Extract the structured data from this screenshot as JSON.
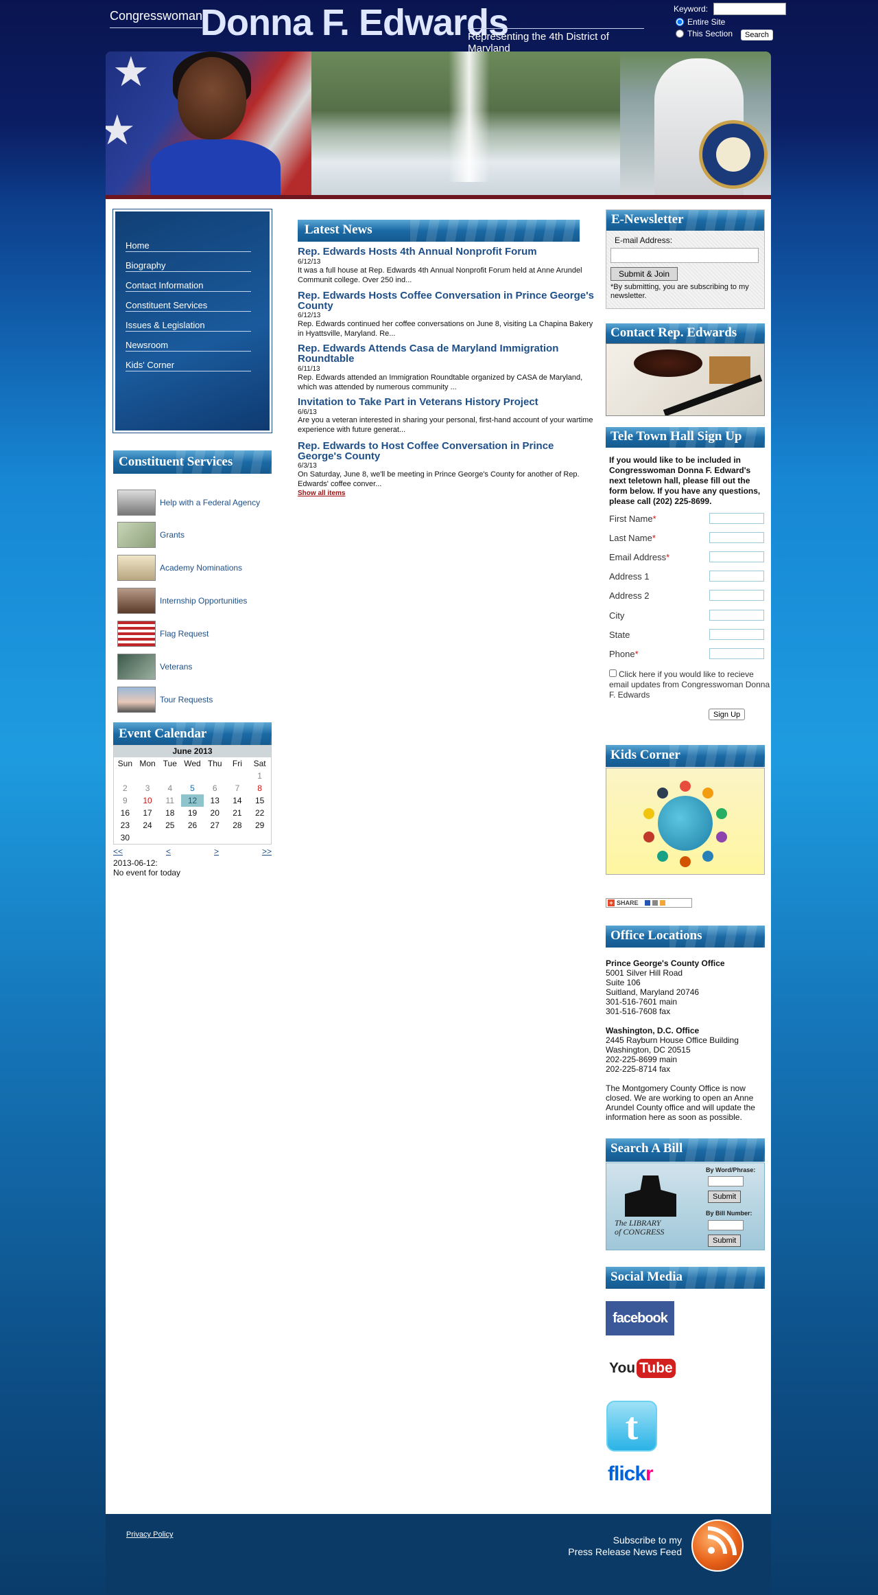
{
  "header": {
    "congresswoman": "Congresswoman",
    "name": "Donna F. Edwards",
    "district": "Representing the 4th District of Maryland"
  },
  "search": {
    "keyword_label": "Keyword:",
    "keyword_value": "",
    "scope_entire": "Entire Site",
    "scope_section": "This Section",
    "selected_scope": "Entire Site",
    "button": "Search"
  },
  "nav": {
    "items": [
      {
        "label": "Home"
      },
      {
        "label": "Biography"
      },
      {
        "label": "Contact Information"
      },
      {
        "label": "Constituent Services"
      },
      {
        "label": "Issues & Legislation"
      },
      {
        "label": "Newsroom"
      },
      {
        "label": "Kids' Corner"
      }
    ]
  },
  "constituent_services": {
    "title": "Constituent Services",
    "items": [
      {
        "label": "Help with a Federal Agency",
        "icon": "federal-building-icon"
      },
      {
        "label": "Grants",
        "icon": "money-icon"
      },
      {
        "label": "Academy Nominations",
        "icon": "academy-building-icon"
      },
      {
        "label": "Internship Opportunities",
        "icon": "intern-icon"
      },
      {
        "label": "Flag Request",
        "icon": "flag-icon"
      },
      {
        "label": "Veterans",
        "icon": "veterans-icon"
      },
      {
        "label": "Tour Requests",
        "icon": "capitol-icon"
      }
    ]
  },
  "calendar": {
    "title": "Event Calendar",
    "month": "June 2013",
    "weekdays": [
      "Sun",
      "Mon",
      "Tue",
      "Wed",
      "Thu",
      "Fri",
      "Sat"
    ],
    "nav_first": "<<",
    "nav_prev": "<",
    "nav_next": ">",
    "nav_last": ">>",
    "selected_date": "2013-06-12:",
    "no_event": "No event for today"
  },
  "news": {
    "title": "Latest News",
    "items": [
      {
        "title": "Rep. Edwards Hosts 4th Annual Nonprofit Forum",
        "date": "6/12/13",
        "body": "It was a full house at Rep. Edwards 4th Annual Nonprofit Forum held at Anne Arundel Communit college.  Over 250 ind..."
      },
      {
        "title": "Rep. Edwards Hosts Coffee Conversation in Prince George's County",
        "date": "6/12/13",
        "body": "Rep. Edwards continued her coffee conversations on June 8, visiting La Chapina Bakery in Hyattsville, Maryland.  Re..."
      },
      {
        "title": "Rep. Edwards Attends Casa de Maryland Immigration Roundtable",
        "date": "6/11/13",
        "body": "Rep. Edwards attended an Immigration Roundtable organized by CASA de Maryland, which was attended by numerous community ..."
      },
      {
        "title": "Invitation to Take Part in Veterans History Project",
        "date": "6/6/13",
        "body": "Are you a veteran interested in sharing your personal, first-hand account of your wartime experience with future generat..."
      },
      {
        "title": "Rep. Edwards to Host Coffee Conversation in Prince George's County",
        "date": "6/3/13",
        "body": "On Saturday, June 8, we'll be meeting in Prince George's County for another of Rep. Edwards' coffee conver..."
      }
    ],
    "show_all": "Show all items"
  },
  "enewsletter": {
    "title": "E-Newsletter",
    "email_label": "E-mail Address:",
    "email_value": "",
    "button": "Submit & Join",
    "note": "*By submitting, you are subscribing to my newsletter."
  },
  "contact": {
    "title": "Contact Rep. Edwards"
  },
  "town_hall": {
    "title": "Tele Town Hall Sign Up",
    "intro": "If you would like to be included in Congresswoman Donna F. Edward's next teletown hall, please fill out the form below. If you have any questions, please call (202) 225-8699.",
    "fields": [
      {
        "label": "First Name",
        "required": "*"
      },
      {
        "label": "Last Name",
        "required": "*"
      },
      {
        "label": "Email Address",
        "required": "*"
      },
      {
        "label": "Address 1",
        "required": ""
      },
      {
        "label": "Address 2",
        "required": ""
      },
      {
        "label": "City",
        "required": ""
      },
      {
        "label": "State",
        "required": ""
      },
      {
        "label": "Phone",
        "required": "*"
      }
    ],
    "checkbox_label": "Click here if you would like to recieve email updates from Congresswoman Donna F. Edwards",
    "button": "Sign Up"
  },
  "kids_corner": {
    "title": "Kids Corner"
  },
  "share": {
    "label": "SHARE"
  },
  "offices": {
    "title": "Office Locations",
    "pg": {
      "name": "Prince George's County Office",
      "lines": [
        "5001 Silver Hill Road",
        "Suite 106",
        "Suitland, Maryland 20746",
        "301-516-7601 main",
        "301-516-7608 fax"
      ]
    },
    "dc": {
      "name": "Washington, D.C. Office",
      "lines": [
        "2445 Rayburn House Office Building",
        "Washington, DC 20515",
        "202-225-8699 main",
        "202-225-8714 fax"
      ]
    },
    "note": "The Montgomery County Office is now closed.  We are working to open an Anne Arundel County office and will update the information here as soon as possible."
  },
  "bill_search": {
    "title": "Search A Bill",
    "logo_line1": "The LIBRARY",
    "logo_line2": "of CONGRESS",
    "by_word": "By Word/Phrase:",
    "by_number": "By Bill Number:",
    "submit": "Submit"
  },
  "social": {
    "title": "Social Media",
    "facebook": "facebook",
    "youtube_you": "You",
    "youtube_tube": "Tube",
    "twitter": "t",
    "flickr_main": "flick",
    "flickr_end": "r"
  },
  "footer": {
    "privacy": "Privacy Policy",
    "subscribe_line1": "Subscribe to my",
    "subscribe_line2": "Press Release News Feed"
  }
}
